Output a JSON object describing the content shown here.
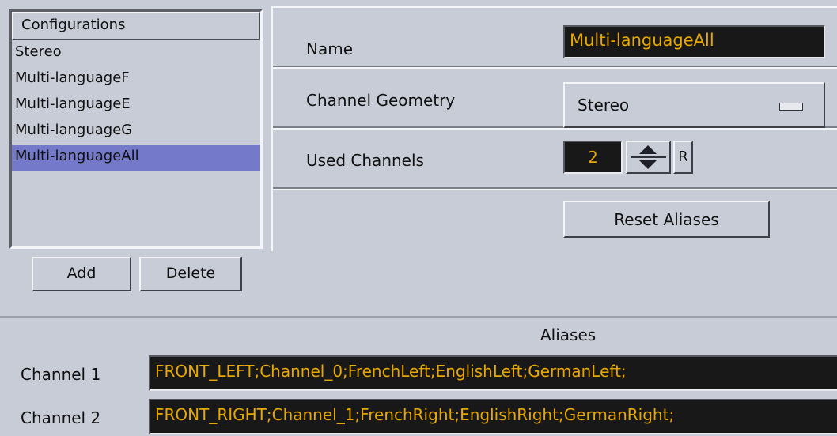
{
  "configurations": {
    "header": "Configurations",
    "items": [
      "Stereo",
      "Multi-languageF",
      "Multi-languageE",
      "Multi-languageG",
      "Multi-languageAll"
    ],
    "selected": "Multi-languageAll"
  },
  "buttons": {
    "add": "Add",
    "delete": "Delete",
    "reset_aliases": "Reset Aliases",
    "r": "R"
  },
  "properties": {
    "name_label": "Name",
    "name_value": "Multi-languageAll",
    "geometry_label": "Channel Geometry",
    "geometry_value": "Stereo",
    "used_channels_label": "Used Channels",
    "used_channels_value": "2"
  },
  "aliases": {
    "title": "Aliases",
    "channels": [
      {
        "label": "Channel 1",
        "value": "FRONT_LEFT;Channel_0;FrenchLeft;EnglishLeft;GermanLeft;"
      },
      {
        "label": "Channel 2",
        "value": "FRONT_RIGHT;Channel_1;FrenchRight;EnglishRight;GermanRight;"
      }
    ]
  },
  "colors": {
    "panel": "#c8ccd6",
    "selection": "#7479c9",
    "field_bg": "#181818",
    "field_text": "#e8a800"
  },
  "icons": {
    "stepper": [
      "arrow-up-icon",
      "arrow-down-icon"
    ],
    "dropdown": "dropdown-handle-icon"
  }
}
